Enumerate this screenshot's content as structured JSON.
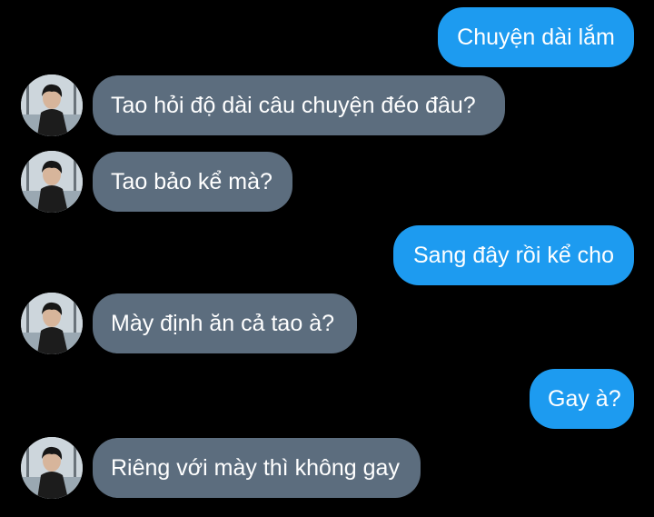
{
  "conversation": {
    "messages": [
      {
        "sender": "me",
        "text": "Chuyện dài lắm"
      },
      {
        "sender": "them",
        "text": "Tao hỏi độ dài câu chuyện đéo đâu?"
      },
      {
        "sender": "them",
        "text": "Tao bảo kể mà?"
      },
      {
        "sender": "me",
        "text": "Sang đây rồi kể cho"
      },
      {
        "sender": "them",
        "text": "Mày định ăn cả tao à?"
      },
      {
        "sender": "me",
        "text": "Gay à?"
      },
      {
        "sender": "them",
        "text": "Riêng với mày thì không gay"
      }
    ]
  },
  "colors": {
    "background": "#000000",
    "outgoing_bubble": "#1d9bf0",
    "incoming_bubble": "#5c6d7e",
    "text": "#ffffff"
  },
  "icons": {
    "avatar": "contact-avatar-photo"
  }
}
